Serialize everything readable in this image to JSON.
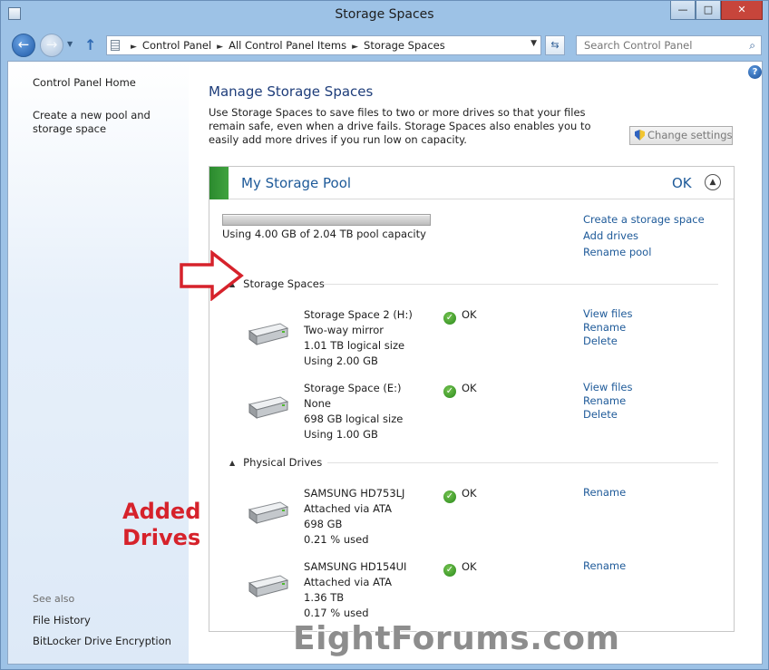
{
  "window": {
    "title": "Storage Spaces"
  },
  "titlebar_buttons": {
    "minimize": "—",
    "maximize": "□",
    "close": "✕"
  },
  "address": {
    "crumbs": [
      "Control Panel",
      "All Control Panel Items",
      "Storage Spaces"
    ]
  },
  "search": {
    "placeholder": "Search Control Panel"
  },
  "sidebar": {
    "home": "Control Panel Home",
    "create_pool": "Create a new pool and storage space",
    "see_also_label": "See also",
    "see_also": [
      "File History",
      "BitLocker Drive Encryption"
    ]
  },
  "annotation": {
    "added_drives_line1": "Added",
    "added_drives_line2": "Drives"
  },
  "main": {
    "title": "Manage Storage Spaces",
    "description": "Use Storage Spaces to save files to two or more drives so that your files remain safe, even when a drive fails. Storage Spaces also enables you to easily add more drives if you run low on capacity.",
    "change_settings": "Change settings"
  },
  "pool": {
    "name": "My Storage Pool",
    "status": "OK",
    "capacity_text": "Using 4.00 GB of 2.04 TB pool capacity",
    "capacity_used_fraction": 0.002,
    "links": [
      "Create a storage space",
      "Add drives",
      "Rename pool"
    ]
  },
  "storage_spaces": {
    "label": "Storage Spaces",
    "items": [
      {
        "name": "Storage Space 2 (H:)",
        "resiliency": "Two-way mirror",
        "size": "1.01 TB logical size",
        "used": "Using 2.00 GB",
        "status": "OK",
        "links": [
          "View files",
          "Rename",
          "Delete"
        ]
      },
      {
        "name": "Storage Space (E:)",
        "resiliency": "None",
        "size": "698 GB logical size",
        "used": "Using 1.00 GB",
        "status": "OK",
        "links": [
          "View files",
          "Rename",
          "Delete"
        ]
      }
    ]
  },
  "physical_drives": {
    "label": "Physical Drives",
    "items": [
      {
        "name": "SAMSUNG HD753LJ",
        "attach": "Attached via ATA",
        "size": "698 GB",
        "used": "0.21 % used",
        "status": "OK",
        "link": "Rename"
      },
      {
        "name": "SAMSUNG HD154UI",
        "attach": "Attached via ATA",
        "size": "1.36 TB",
        "used": "0.17 % used",
        "status": "OK",
        "link": "Rename"
      }
    ]
  },
  "watermark": "EightForums.com"
}
